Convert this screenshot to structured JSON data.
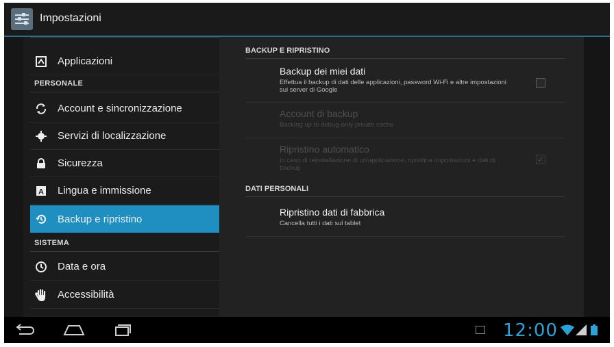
{
  "action_bar": {
    "title": "Impostazioni",
    "icon": "settings-sliders-icon"
  },
  "sidebar": {
    "items": [
      {
        "label": "Applicazioni",
        "icon": "apps-icon"
      },
      {
        "label": "Account e sincronizzazione",
        "icon": "sync-icon"
      },
      {
        "label": "Servizi di localizzazione",
        "icon": "location-icon"
      },
      {
        "label": "Sicurezza",
        "icon": "lock-icon"
      },
      {
        "label": "Lingua e immissione",
        "icon": "keyboard-icon"
      },
      {
        "label": "Backup e ripristino",
        "icon": "backup-icon",
        "selected": true
      },
      {
        "label": "Data e ora",
        "icon": "clock-icon"
      },
      {
        "label": "Accessibilità",
        "icon": "hand-icon"
      }
    ],
    "headers": {
      "personale": "PERSONALE",
      "sistema": "SISTEMA"
    }
  },
  "main": {
    "section_backup": "BACKUP E RIPRISTINO",
    "section_personal": "DATI PERSONALI",
    "prefs": [
      {
        "title": "Backup dei miei dati",
        "summary": "Effettua il backup di dati delle applicazioni, password Wi-Fi e altre impostazioni sui server di Google",
        "checked": false,
        "enabled": true
      },
      {
        "title": "Account di backup",
        "summary": "Backing up to debug-only private cache",
        "enabled": false
      },
      {
        "title": "Ripristino automatico",
        "summary": "In caso di reinstallazione di un'applicazione, ripristina impostazioni e dati di backup",
        "checked": true,
        "enabled": false
      },
      {
        "title": "Ripristino dati di fabbrica",
        "summary": "Cancella tutti i dati sul tablet",
        "enabled": true
      }
    ]
  },
  "status_bar": {
    "time": "12:00",
    "accent": "#2ea2d6"
  },
  "colors": {
    "selected": "#1f8fc2",
    "accent_line": "#2a6e8f"
  }
}
